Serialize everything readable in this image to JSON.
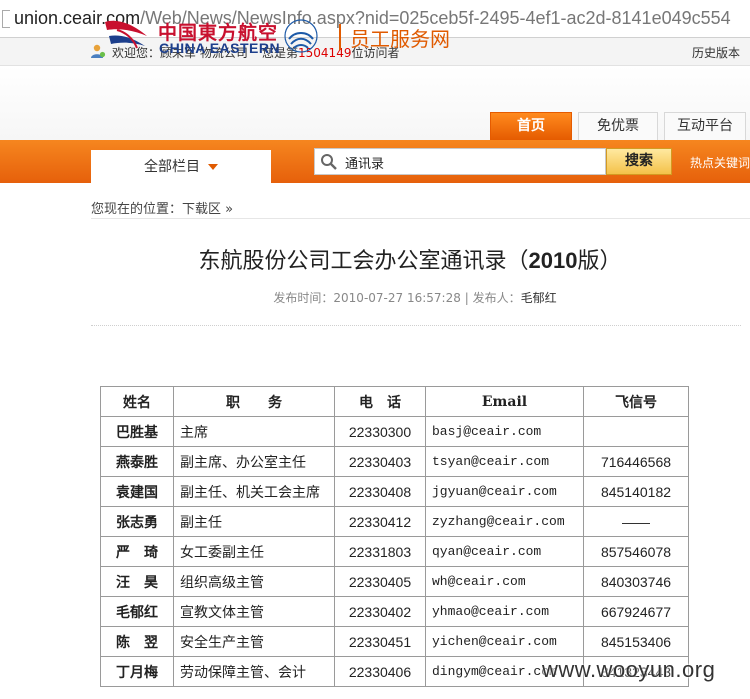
{
  "browser": {
    "url_host": "union.ceair.com",
    "url_path": "/Web/News/NewsInfo.aspx?nid=025ceb5f-2495-4ef1-ac2d-8141e049c554"
  },
  "infobar": {
    "welcome": "欢迎您：顾未军 物流公司",
    "visitor_prefix": "您是第",
    "visitor_count": "1504149",
    "visitor_suffix": "位访问者",
    "history_label": "历史版本"
  },
  "header": {
    "logo_cn": "中国東方航空",
    "logo_en": "CHINA EASTERN",
    "service_name": "员工服务网",
    "tabs": [
      {
        "label": "首页"
      },
      {
        "label": "免优票"
      },
      {
        "label": "互动平台"
      }
    ]
  },
  "nav": {
    "all_categories": "全部栏目",
    "search_value": "通讯录",
    "search_button": "搜索",
    "hot_keywords": "热点关键词"
  },
  "breadcrumb": {
    "prefix": "您现在的位置：",
    "current": "下载区",
    "arrow": "»"
  },
  "article": {
    "title_main": "东航股份公司工会办公室通讯录（",
    "title_year": "2010",
    "title_tail": "版）",
    "meta_label": "发布时间：",
    "meta_time": "2010-07-27 16:57:28",
    "meta_sep": "|",
    "meta_author_label": "发布人：",
    "meta_author": "毛郁红"
  },
  "table": {
    "headers": [
      "姓名",
      "职　　务",
      "电　话",
      "Email",
      "飞信号"
    ],
    "rows": [
      {
        "name": "巴胜基",
        "position": "主席",
        "phone": "22330300",
        "email": "basj@ceair.com",
        "fetion": ""
      },
      {
        "name": "燕泰胜",
        "position": "副主席、办公室主任",
        "phone": "22330403",
        "email": "tsyan@ceair.com",
        "fetion": "716446568"
      },
      {
        "name": "袁建国",
        "position": "副主任、机关工会主席",
        "phone": "22330408",
        "email": "jgyuan@ceair.com",
        "fetion": "845140182"
      },
      {
        "name": "张志勇",
        "position": "副主任",
        "phone": "22330412",
        "email": "zyzhang@ceair.com",
        "fetion": "——"
      },
      {
        "name": "严　琦",
        "position": "女工委副主任",
        "phone": "22331803",
        "email": "qyan@ceair.com",
        "fetion": "857546078"
      },
      {
        "name": "汪　昊",
        "position": "组织高级主管",
        "phone": "22330405",
        "email": "wh@ceair.com",
        "fetion": "840303746"
      },
      {
        "name": "毛郁红",
        "position": "宣教文体主管",
        "phone": "22330402",
        "email": "yhmao@ceair.com",
        "fetion": "667924677"
      },
      {
        "name": "陈　翌",
        "position": "安全生产主管",
        "phone": "22330451",
        "email": "yichen@ceair.com",
        "fetion": "845153406"
      },
      {
        "name": "丁月梅",
        "position": "劳动保障主管、会计",
        "phone": "22330406",
        "email": "dingym@ceair.com",
        "fetion": "841323443"
      }
    ]
  },
  "watermark": "www.wooyun.org"
}
